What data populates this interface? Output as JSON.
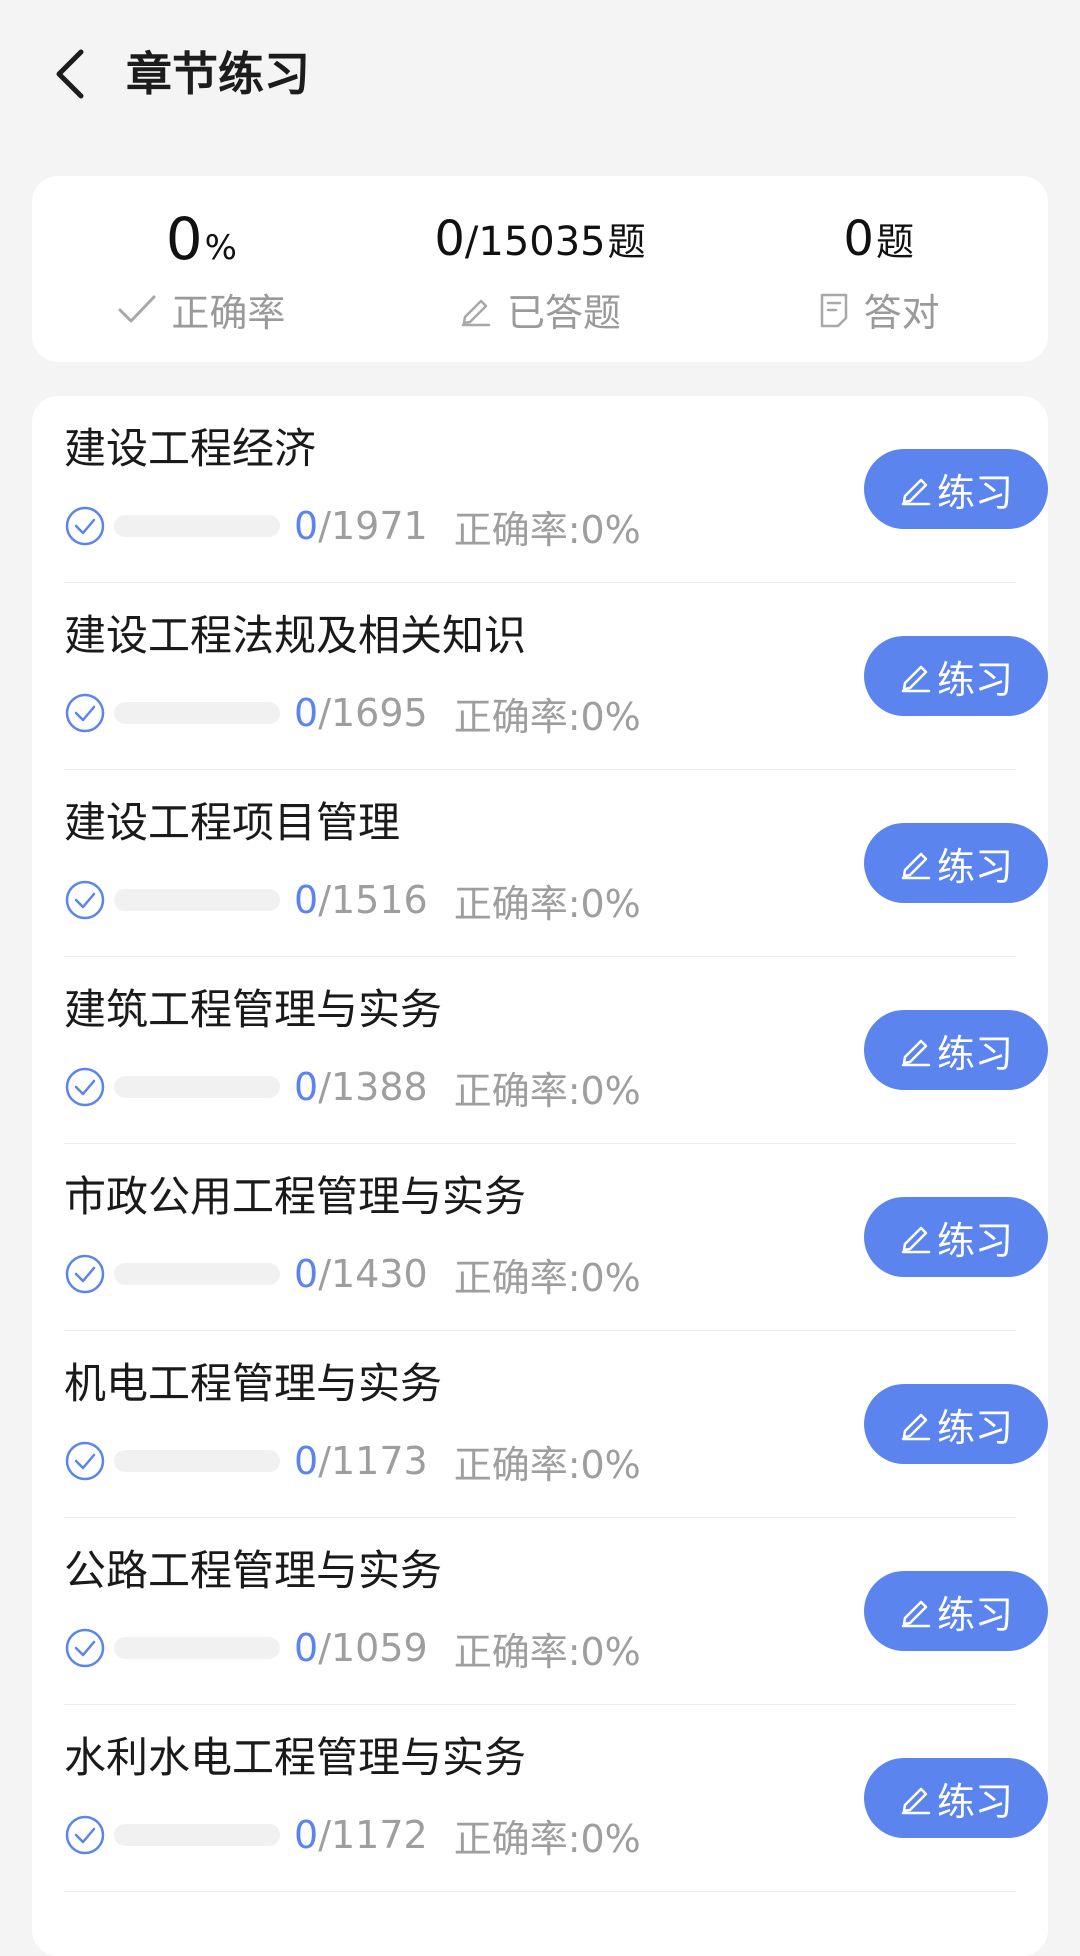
{
  "header": {
    "back_icon": "chevron-left-icon",
    "title": "章节练习"
  },
  "summary": {
    "accuracy_value": "0",
    "accuracy_unit": "%",
    "accuracy_label": "正确率",
    "answered_done": "0",
    "answered_total": "/15035",
    "answered_unit": "题",
    "answered_label": "已答题",
    "correct_value": "0",
    "correct_unit": "题",
    "correct_label": "答对"
  },
  "chapters": [
    {
      "title": "建设工程经济",
      "done": "0",
      "total": "/1971",
      "accuracy": "正确率:0%",
      "progress": 0,
      "button": "练习"
    },
    {
      "title": "建设工程法规及相关知识",
      "done": "0",
      "total": "/1695",
      "accuracy": "正确率:0%",
      "progress": 0,
      "button": "练习"
    },
    {
      "title": "建设工程项目管理",
      "done": "0",
      "total": "/1516",
      "accuracy": "正确率:0%",
      "progress": 0,
      "button": "练习"
    },
    {
      "title": "建筑工程管理与实务",
      "done": "0",
      "total": "/1388",
      "accuracy": "正确率:0%",
      "progress": 0,
      "button": "练习"
    },
    {
      "title": "市政公用工程管理与实务",
      "done": "0",
      "total": "/1430",
      "accuracy": "正确率:0%",
      "progress": 0,
      "button": "练习"
    },
    {
      "title": "机电工程管理与实务",
      "done": "0",
      "total": "/1173",
      "accuracy": "正确率:0%",
      "progress": 0,
      "button": "练习"
    },
    {
      "title": "公路工程管理与实务",
      "done": "0",
      "total": "/1059",
      "accuracy": "正确率:0%",
      "progress": 0,
      "button": "练习"
    },
    {
      "title": "水利水电工程管理与实务",
      "done": "0",
      "total": "/1172",
      "accuracy": "正确率:0%",
      "progress": 0,
      "button": "练习"
    }
  ],
  "colors": {
    "accent": "#5b84ee",
    "background": "#f4f4f4",
    "muted_text": "#9e9e9e"
  }
}
